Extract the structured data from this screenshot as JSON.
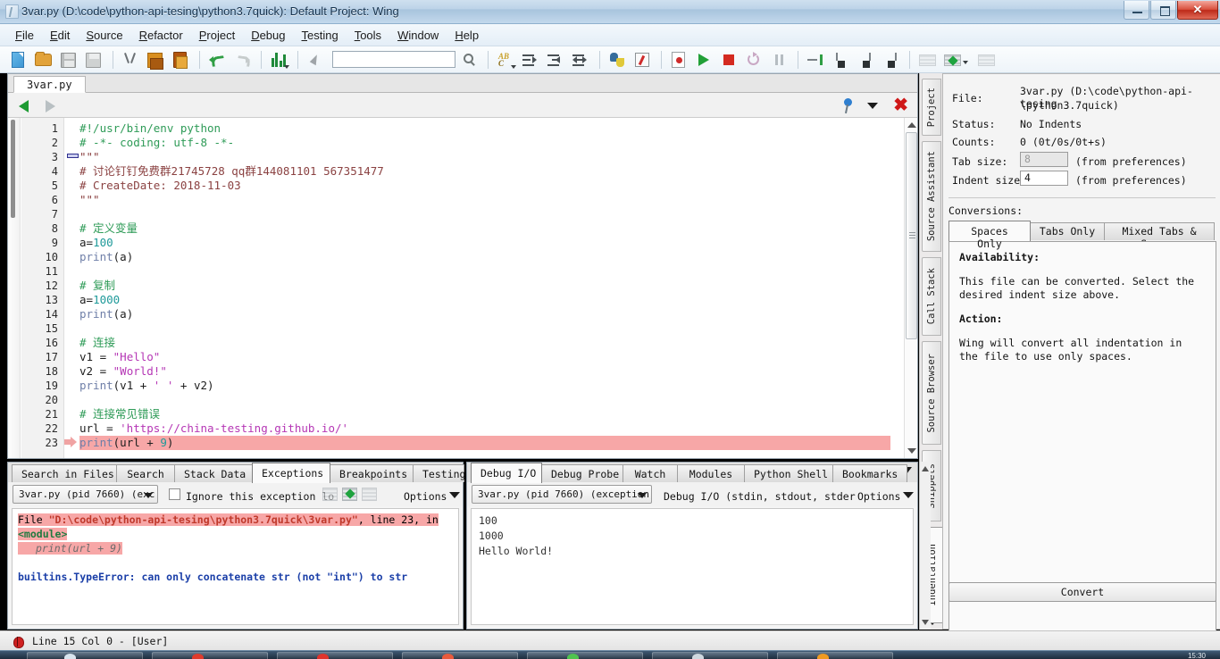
{
  "window": {
    "title": "3var.py (D:\\code\\python-api-tesing\\python3.7quick): Default Project: Wing",
    "minimize_label": "",
    "restore_label": "",
    "close_label": ""
  },
  "menu": [
    {
      "label": "File",
      "accel": "F"
    },
    {
      "label": "Edit",
      "accel": "E"
    },
    {
      "label": "Source",
      "accel": "S"
    },
    {
      "label": "Refactor",
      "accel": "R"
    },
    {
      "label": "Project",
      "accel": "P"
    },
    {
      "label": "Debug",
      "accel": "D"
    },
    {
      "label": "Testing",
      "accel": "T"
    },
    {
      "label": "Tools",
      "accel": "T"
    },
    {
      "label": "Window",
      "accel": "W"
    },
    {
      "label": "Help",
      "accel": "H"
    }
  ],
  "toolbar": {
    "search_value": "",
    "icons": [
      "new-file-icon",
      "open-folder-icon",
      "save-icon",
      "save-all-icon",
      "cut-icon",
      "copy-icon",
      "paste-icon",
      "undo-icon",
      "redo-icon",
      "bar-chart-icon",
      "select-pointer-icon",
      "search-icon",
      "replace-icon",
      "indent-right-icon",
      "indent-left-icon",
      "indent-both-icon",
      "python-shell-icon",
      "debug-probe-icon",
      "debug-file-icon",
      "run-icon",
      "stop-icon",
      "restart-icon",
      "pause-icon",
      "step-into-icon",
      "step-over-icon",
      "step-out-icon",
      "step-return-icon",
      "breakpoint-disabled-icon",
      "breakpoint-icon",
      "breakpoint-clear-icon"
    ]
  },
  "editor": {
    "tab_label": "3var.py",
    "nav_back": "nav-back-icon",
    "nav_forward": "nav-forward-icon",
    "pin": "pin-icon",
    "chevron": "chevron-down-icon",
    "close": "close-icon",
    "lines": [
      {
        "n": 1,
        "tokens": [
          {
            "t": "#!/usr/bin/env python",
            "c": "tk-com"
          }
        ]
      },
      {
        "n": 2,
        "tokens": [
          {
            "t": "# -*- coding: utf-8 -*-",
            "c": "tk-com"
          }
        ]
      },
      {
        "n": 3,
        "tokens": [
          {
            "t": "\"\"\"",
            "c": "tk-com2"
          }
        ],
        "fold": true
      },
      {
        "n": 4,
        "tokens": [
          {
            "t": "# 讨论钉钉免费群21745728 qq群144081101 567351477",
            "c": "tk-com2"
          }
        ]
      },
      {
        "n": 5,
        "tokens": [
          {
            "t": "# CreateDate: 2018-11-03",
            "c": "tk-com2"
          }
        ]
      },
      {
        "n": 6,
        "tokens": [
          {
            "t": "\"\"\"",
            "c": "tk-com2"
          }
        ]
      },
      {
        "n": 7,
        "tokens": []
      },
      {
        "n": 8,
        "tokens": [
          {
            "t": "# 定义变量",
            "c": "tk-com"
          }
        ]
      },
      {
        "n": 9,
        "tokens": [
          {
            "t": "a=",
            "c": "tk-op"
          },
          {
            "t": "100",
            "c": "tk-num"
          }
        ]
      },
      {
        "n": 10,
        "tokens": [
          {
            "t": "print",
            "c": "tk-kw"
          },
          {
            "t": "(a)",
            "c": "tk-op"
          }
        ]
      },
      {
        "n": 11,
        "tokens": []
      },
      {
        "n": 12,
        "tokens": [
          {
            "t": "# 复制",
            "c": "tk-com"
          }
        ]
      },
      {
        "n": 13,
        "tokens": [
          {
            "t": "a=",
            "c": "tk-op"
          },
          {
            "t": "1000",
            "c": "tk-num"
          }
        ]
      },
      {
        "n": 14,
        "tokens": [
          {
            "t": "print",
            "c": "tk-kw"
          },
          {
            "t": "(a)",
            "c": "tk-op"
          }
        ]
      },
      {
        "n": 15,
        "tokens": []
      },
      {
        "n": 16,
        "tokens": [
          {
            "t": "# 连接",
            "c": "tk-com"
          }
        ]
      },
      {
        "n": 17,
        "tokens": [
          {
            "t": "v1 = ",
            "c": "tk-op"
          },
          {
            "t": "\"Hello\"",
            "c": "tk-str"
          }
        ]
      },
      {
        "n": 18,
        "tokens": [
          {
            "t": "v2 = ",
            "c": "tk-op"
          },
          {
            "t": "\"World!\"",
            "c": "tk-str"
          }
        ]
      },
      {
        "n": 19,
        "tokens": [
          {
            "t": "print",
            "c": "tk-kw"
          },
          {
            "t": "(v1 + ",
            "c": "tk-op"
          },
          {
            "t": "' '",
            "c": "tk-str"
          },
          {
            "t": " + v2)",
            "c": "tk-op"
          }
        ]
      },
      {
        "n": 20,
        "tokens": []
      },
      {
        "n": 21,
        "tokens": [
          {
            "t": "# 连接常见错误",
            "c": "tk-com"
          }
        ]
      },
      {
        "n": 22,
        "tokens": [
          {
            "t": "url = ",
            "c": "tk-op"
          },
          {
            "t": "'https://china-testing.github.io/'",
            "c": "tk-str"
          }
        ]
      },
      {
        "n": 23,
        "tokens": [
          {
            "t": "print",
            "c": "tk-kw"
          },
          {
            "t": "(url + ",
            "c": "tk-op"
          },
          {
            "t": "9",
            "c": "tk-num"
          },
          {
            "t": ")",
            "c": "tk-op"
          }
        ],
        "error": true,
        "arrow": true
      }
    ]
  },
  "vertical_tabs": [
    {
      "label": "Project",
      "active": false
    },
    {
      "label": "Source Assistant",
      "active": false
    },
    {
      "label": "Call Stack",
      "active": false
    },
    {
      "label": "Source Browser",
      "active": false
    },
    {
      "label": "Snippets",
      "active": false
    },
    {
      "label": "Indentation",
      "active": true
    }
  ],
  "indentation_panel": {
    "file_label": "File:",
    "file_value_line1": "3var.py (D:\\code\\python-api-tesing",
    "file_value_line2": "\\python3.7quick)",
    "status_label": "Status:",
    "status_value": "No Indents",
    "counts_label": "Counts:",
    "counts_value": "0 (0t/0s/0t+s)",
    "tab_size_label": "Tab size:",
    "tab_size_value": "8",
    "tab_size_hint": "(from preferences)",
    "indent_size_label": "Indent size:",
    "indent_size_value": "4",
    "indent_size_hint": "(from preferences)",
    "conversions_label": "Conversions:",
    "conversion_tabs": [
      {
        "label": "Spaces Only",
        "active": true
      },
      {
        "label": "Tabs Only",
        "active": false
      },
      {
        "label": "Mixed Tabs & Spaces",
        "active": false
      }
    ],
    "availability_heading": "Availability:",
    "availability_text": "This file can be converted. Select the desired indent size above.",
    "action_heading": "Action:",
    "action_text": "Wing will convert all indentation in the file to use only spaces.",
    "convert_button": "Convert"
  },
  "bottom_left": {
    "tabs": [
      {
        "label": "Search in Files",
        "active": false
      },
      {
        "label": "Search",
        "active": false
      },
      {
        "label": "Stack Data",
        "active": false
      },
      {
        "label": "Exceptions",
        "active": true
      },
      {
        "label": "Breakpoints",
        "active": false
      },
      {
        "label": "Testing",
        "active": false
      }
    ],
    "process_combo": "3var.py (pid 7660) (exc",
    "ignore_checkbox_label": "Ignore this exception lo",
    "options_label": "Options",
    "exception": {
      "file_prefix": "File ",
      "file_path": "\"D:\\code\\python-api-tesing\\python3.7quick\\3var.py\"",
      "file_suffix": ", line 23, in",
      "module": "<module>",
      "source_line": "print(url + 9)",
      "error_text": "builtins.TypeError: can only concatenate str (not \"int\") to str"
    }
  },
  "bottom_right": {
    "tabs": [
      {
        "label": "Debug I/O",
        "active": true
      },
      {
        "label": "Debug Probe",
        "active": false
      },
      {
        "label": "Watch",
        "active": false
      },
      {
        "label": "Modules",
        "active": false
      },
      {
        "label": "Python Shell",
        "active": false
      },
      {
        "label": "Bookmarks",
        "active": false
      }
    ],
    "process_combo": "3var.py (pid 7660) (exception)",
    "stream_label": "Debug I/O (stdin, stdout, stder",
    "options_label": "Options",
    "output": [
      "100",
      "1000",
      "Hello World!"
    ]
  },
  "statusbar": {
    "icon": "bug-icon",
    "text": "Line 15 Col 0 - [User]"
  },
  "taskbar": {
    "clock": "15:30"
  }
}
